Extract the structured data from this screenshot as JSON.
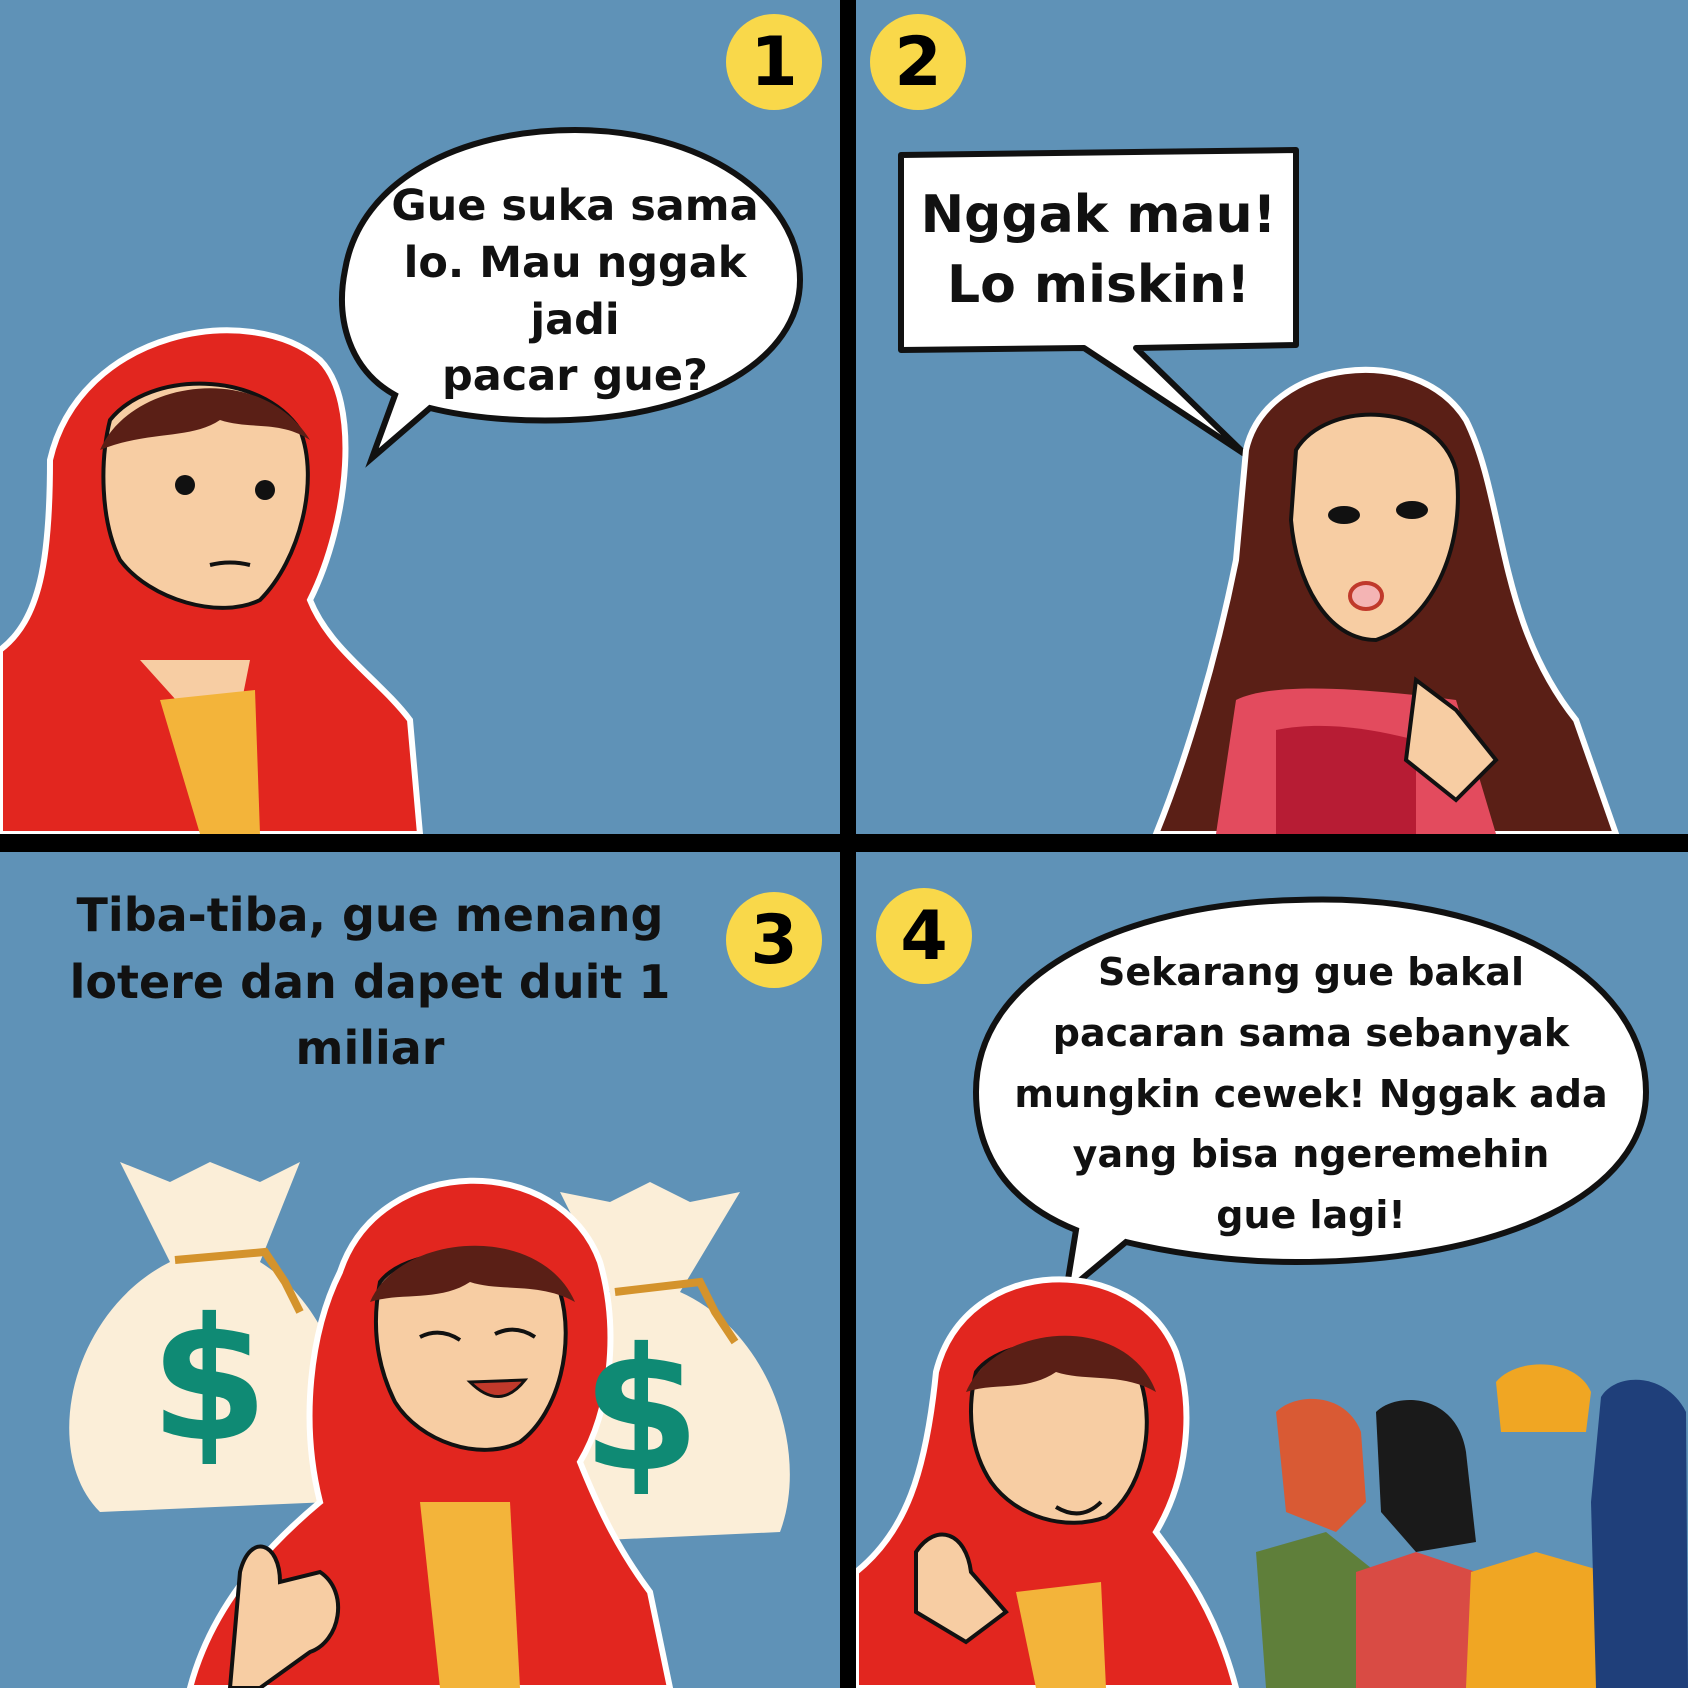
{
  "panels": [
    {
      "number": "1",
      "speech": "Gue suka sama\nlo. Mau nggak jadi\npacar gue?"
    },
    {
      "number": "2",
      "speech": "Nggak mau!\nLo miskin!"
    },
    {
      "number": "3",
      "narration": "Tiba-tiba, gue menang\nlotere dan dapet duit 1 miliar",
      "money_symbol": "$"
    },
    {
      "number": "4",
      "speech": "Sekarang gue bakal\npacaran sama sebanyak\nmungkin cewek! Nggak ada\nyang bisa ngeremehin\ngue lagi!"
    }
  ],
  "colors": {
    "panel_background": "#5f92b7",
    "gutter": "#000000",
    "badge": "#f9d84a",
    "hoodie": "#e2261f",
    "tshirt": "#f3b43a",
    "skin": "#f7cda3",
    "hair": "#5a1f16",
    "money_bag": "#fbeed8",
    "money_symbol": "#0f8a74"
  }
}
